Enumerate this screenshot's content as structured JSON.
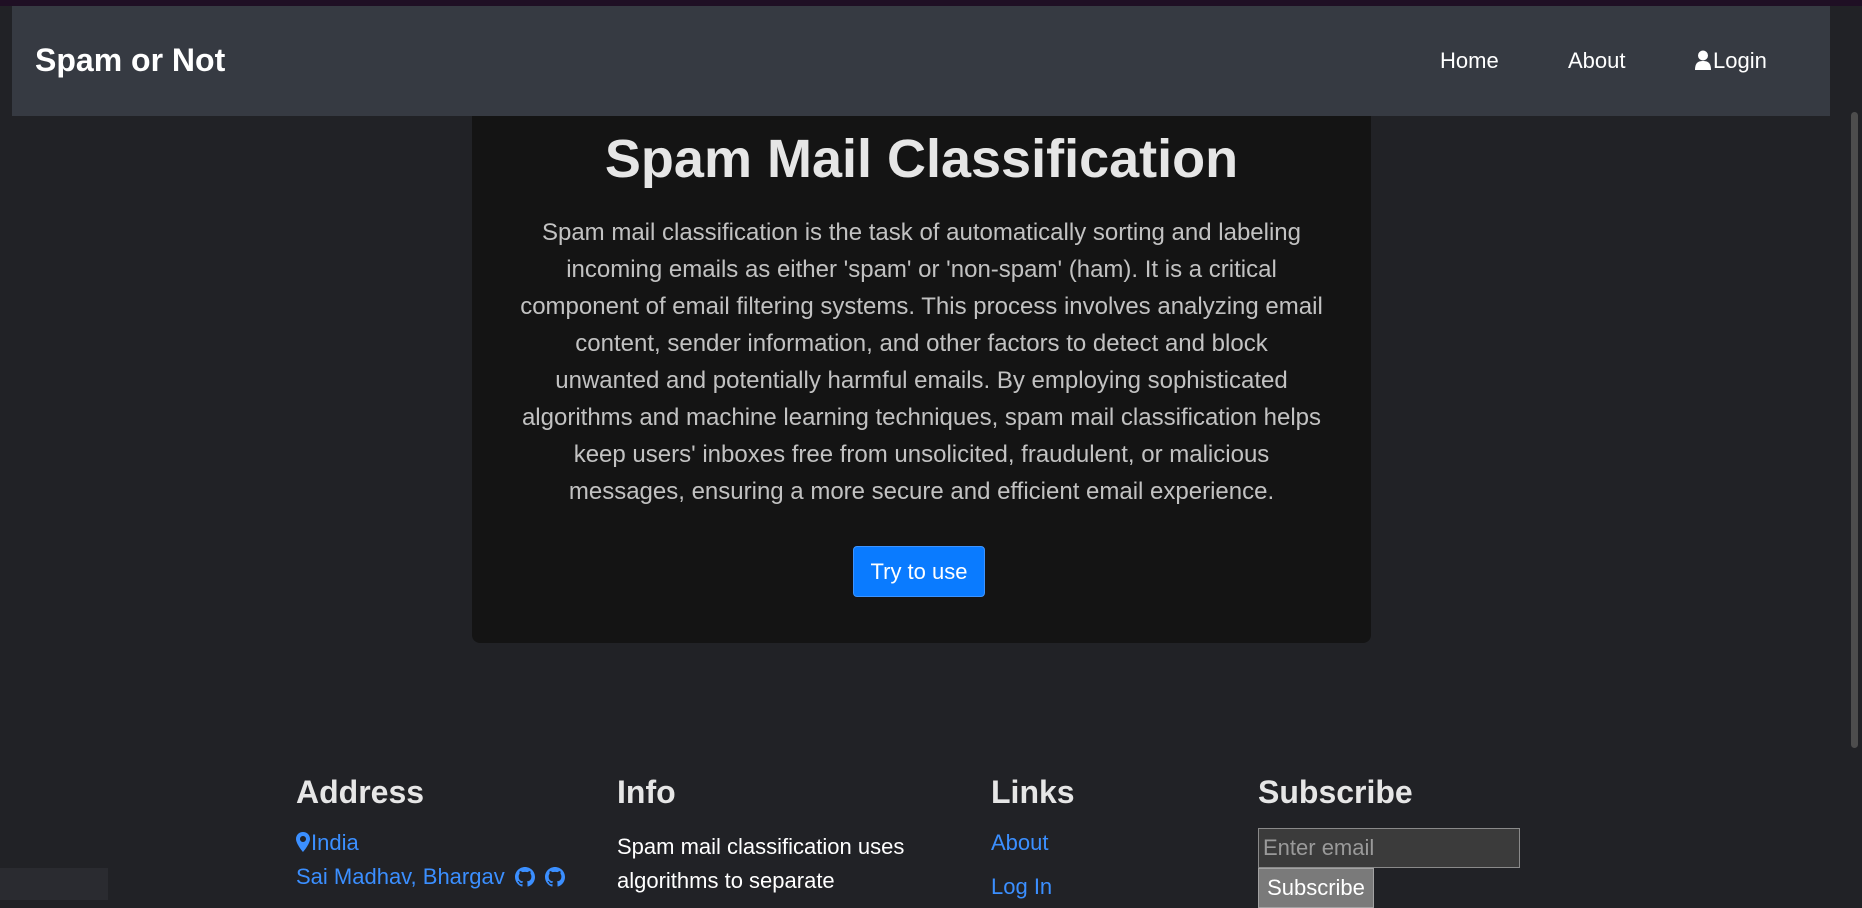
{
  "navbar": {
    "brand": "Spam or Not",
    "links": [
      {
        "label": "Home"
      },
      {
        "label": "About"
      },
      {
        "label": "Login",
        "icon": "user-icon"
      }
    ]
  },
  "hero": {
    "title": "Spam Mail Classification",
    "description": "Spam mail classification is the task of automatically sorting and labeling incoming emails as either 'spam' or 'non-spam' (ham). It is a critical component of email filtering systems. This process involves analyzing email content, sender information, and other factors to detect and block unwanted and potentially harmful emails. By employing sophisticated algorithms and machine learning techniques, spam mail classification helps keep users' inboxes free from unsolicited, fraudulent, or malicious messages, ensuring a more secure and efficient email experience.",
    "button_label": "Try to use"
  },
  "footer": {
    "address": {
      "heading": "Address",
      "location": "India",
      "location_icon": "map-pin-icon",
      "authors": "Sai Madhav, Bhargav",
      "author_icons": [
        "github-icon",
        "github-icon"
      ]
    },
    "info": {
      "heading": "Info",
      "text": "Spam mail classification uses algorithms to separate"
    },
    "links": {
      "heading": "Links",
      "items": [
        "About",
        "Log In"
      ]
    },
    "subscribe": {
      "heading": "Subscribe",
      "email_placeholder": "Enter email",
      "button_label": "Subscribe"
    }
  },
  "colors": {
    "background": "#212226",
    "navbar": "#363a42",
    "hero_card": "#141414",
    "primary_button": "#0a7bff",
    "link": "#3b8fff"
  }
}
